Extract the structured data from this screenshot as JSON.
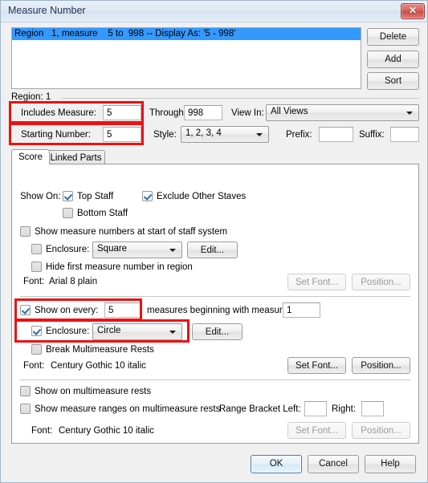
{
  "window": {
    "title": "Measure Number",
    "close_icon": "close-icon",
    "close_glyph": "✕"
  },
  "region_list": {
    "selected_row": "Region   1, measure    5 to  998 -- Display As: '5 - 998'",
    "buttons": {
      "delete": "Delete",
      "add": "Add",
      "sort": "Sort"
    }
  },
  "region_header": {
    "label": "Region: 1"
  },
  "region_fields": {
    "includes_measure_label": "Includes Measure:",
    "includes_measure_value": "5",
    "through_label": "Through:",
    "through_value": "998",
    "view_in_label": "View In:",
    "view_in_value": "All Views",
    "starting_number_label": "Starting Number:",
    "starting_number_value": "5",
    "style_label": "Style:",
    "style_value": "1, 2, 3, 4",
    "prefix_label": "Prefix:",
    "prefix_value": "",
    "suffix_label": "Suffix:",
    "suffix_value": ""
  },
  "tabs": [
    {
      "label": "Score",
      "active": true
    },
    {
      "label": "Linked Parts",
      "active": false
    }
  ],
  "score_panel": {
    "show_on_label": "Show On:",
    "top_staff": {
      "label": "Top Staff",
      "checked": true
    },
    "exclude_other_staves": {
      "label": "Exclude Other Staves",
      "checked": true
    },
    "bottom_staff": {
      "label": "Bottom Staff",
      "checked": false
    },
    "show_at_start_of_system": {
      "label": "Show measure numbers at start of staff system",
      "checked": false
    },
    "enclosure_1": {
      "label": "Enclosure:",
      "checked": false,
      "value": "Square",
      "edit_label": "Edit..."
    },
    "hide_first": {
      "label": "Hide first measure number in region",
      "checked": false
    },
    "font_1": {
      "label": "Font:",
      "value": "Arial 8 plain"
    },
    "set_font_1": {
      "label": "Set Font...",
      "enabled": false
    },
    "position_1": {
      "label": "Position...",
      "enabled": false
    },
    "show_on_every": {
      "label": "Show on every:",
      "checked": true,
      "value": "5"
    },
    "measures_beginning_label": "measures beginning with measure:",
    "measures_beginning_value": "1",
    "enclosure_2": {
      "label": "Enclosure:",
      "checked": true,
      "value": "Circle",
      "edit_label": "Edit..."
    },
    "break_multimeasure": {
      "label": "Break Multimeasure Rests",
      "checked": false
    },
    "font_2": {
      "label": "Font:",
      "value": "Century Gothic 10  italic"
    },
    "set_font_2": {
      "label": "Set Font...",
      "enabled": true
    },
    "position_2": {
      "label": "Position...",
      "enabled": true
    },
    "show_on_multimeasure": {
      "label": "Show on multimeasure rests",
      "checked": false
    },
    "show_ranges_on_multimeasure": {
      "label": "Show measure ranges on multimeasure rests",
      "checked": false
    },
    "range_bracket_left_label": "Range Bracket Left:",
    "range_bracket_left_value": "",
    "range_bracket_right_label": "Right:",
    "range_bracket_right_value": "",
    "font_3": {
      "label": "Font:",
      "value": "Century Gothic 10  italic"
    },
    "set_font_3": {
      "label": "Set Font...",
      "enabled": false
    },
    "position_3": {
      "label": "Position...",
      "enabled": false
    }
  },
  "footer": {
    "ok": "OK",
    "cancel": "Cancel",
    "help": "Help"
  },
  "annotations": {
    "accent_color": "#ee1111",
    "highlight_boxes": [
      "includes-measure-row",
      "starting-number-row",
      "show-on-every-row",
      "enclosure-circle-row"
    ]
  }
}
